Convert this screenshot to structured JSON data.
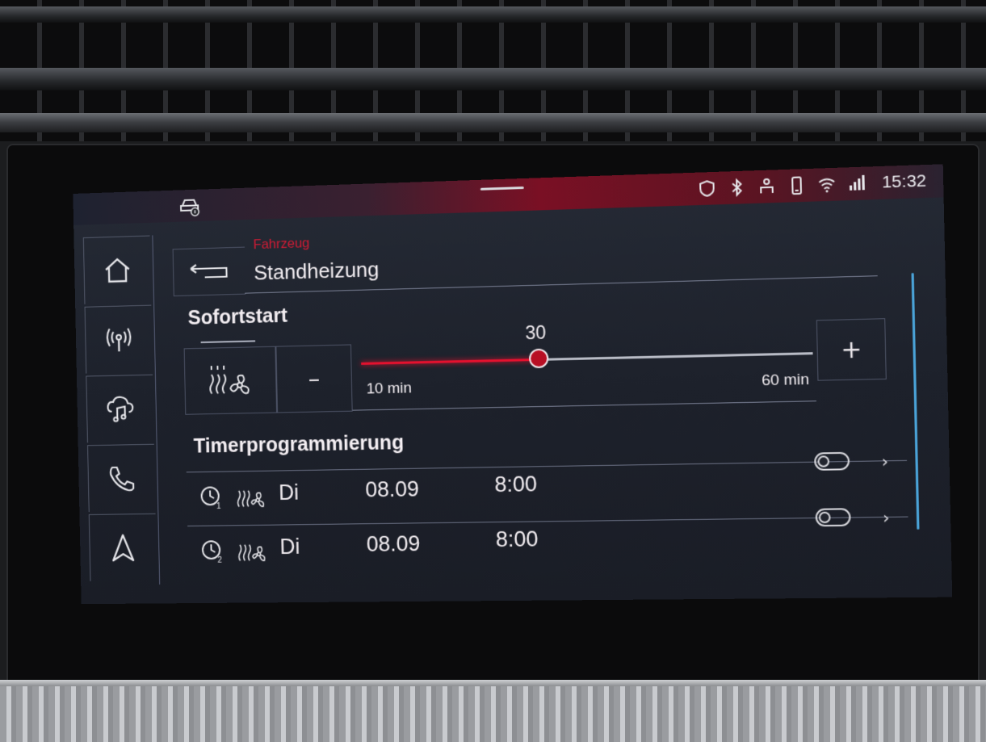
{
  "status_bar": {
    "time": "15:32",
    "icons": [
      "car-info-icon",
      "location-shield-icon",
      "bluetooth-icon",
      "driver-profile-icon",
      "phone-icon",
      "wifi-icon",
      "lte-signal-icon"
    ]
  },
  "side_nav": [
    {
      "name": "home",
      "icon": "home-icon"
    },
    {
      "name": "radio",
      "icon": "radio-icon"
    },
    {
      "name": "media",
      "icon": "music-cloud-icon"
    },
    {
      "name": "phone",
      "icon": "phone-icon"
    },
    {
      "name": "navigation",
      "icon": "navigation-arrow-icon"
    }
  ],
  "header": {
    "breadcrumb": "Fahrzeug",
    "title": "Standheizung",
    "back_icon": "back-arrow-icon"
  },
  "sofortstart": {
    "label": "Sofortstart",
    "mode_icon": "heating-fan-icon",
    "minus_label": "–",
    "plus_label": "+",
    "duration": {
      "value": "30",
      "min_label": "10 min",
      "max_label": "60 min",
      "min": 10,
      "max": 60,
      "current": 30
    }
  },
  "timer": {
    "label": "Timerprogrammierung",
    "entries": [
      {
        "index": "1",
        "day": "Di",
        "date": "08.09",
        "time": "8:00",
        "enabled": false
      },
      {
        "index": "2",
        "day": "Di",
        "date": "08.09",
        "time": "8:00",
        "enabled": false
      }
    ]
  },
  "colors": {
    "accent": "#e4112e",
    "scrollbar": "#4aa3d8",
    "background": "#1d212b"
  }
}
